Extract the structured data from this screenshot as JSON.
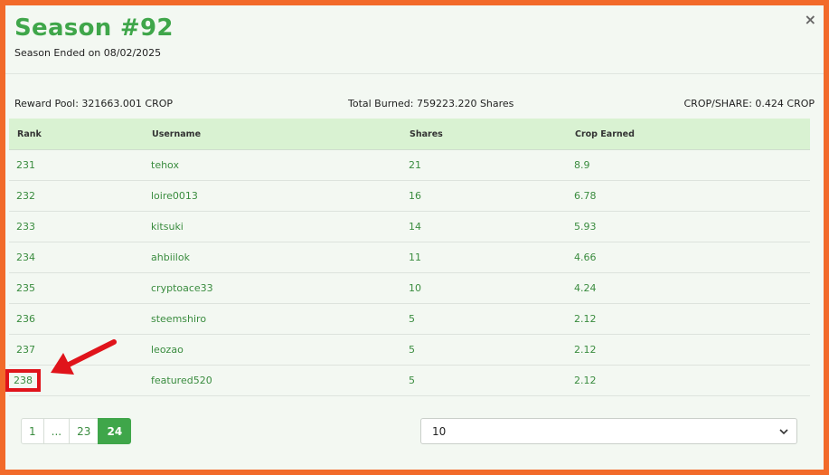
{
  "modal": {
    "title": "Season #92",
    "subtitle": "Season Ended on 08/02/2025",
    "close_icon": "×"
  },
  "summary": {
    "reward_pool": "Reward Pool: 321663.001 CROP",
    "total_burned": "Total Burned: 759223.220 Shares",
    "crop_per_share": "CROP/SHARE: 0.424 CROP"
  },
  "table": {
    "headers": [
      "Rank",
      "Username",
      "Shares",
      "Crop Earned"
    ],
    "rows": [
      [
        "231",
        "tehox",
        "21",
        "8.9"
      ],
      [
        "232",
        "loire0013",
        "16",
        "6.78"
      ],
      [
        "233",
        "kitsuki",
        "14",
        "5.93"
      ],
      [
        "234",
        "ahbiilok",
        "11",
        "4.66"
      ],
      [
        "235",
        "cryptoace33",
        "10",
        "4.24"
      ],
      [
        "236",
        "steemshiro",
        "5",
        "2.12"
      ],
      [
        "237",
        "leozao",
        "5",
        "2.12"
      ],
      [
        "238",
        "featured520",
        "5",
        "2.12"
      ]
    ]
  },
  "pagination": {
    "pages": [
      "1",
      "...",
      "23",
      "24"
    ],
    "active": "24"
  },
  "page_size_select": {
    "value": "10"
  },
  "colors": {
    "accent": "#3fa64a",
    "highlight": "#e0141b",
    "frame": "#f26a2a"
  }
}
